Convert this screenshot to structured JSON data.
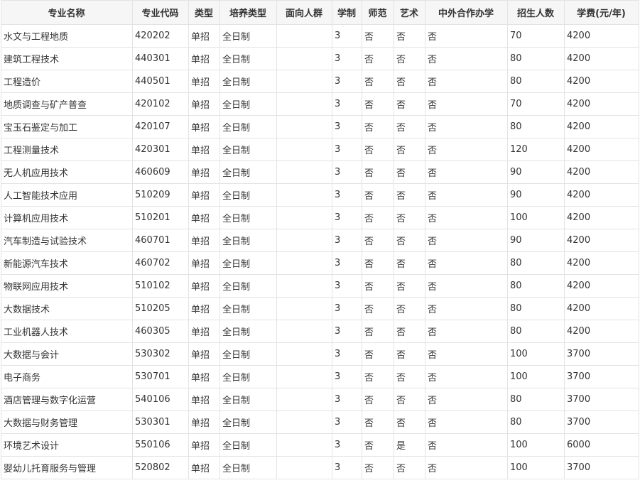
{
  "table": {
    "headers": [
      "专业名称",
      "专业代码",
      "类型",
      "培养类型",
      "面向人群",
      "学制",
      "师范",
      "艺术",
      "中外合作办学",
      "招生人数",
      "学费(元/年)"
    ],
    "rows": [
      [
        "水文与工程地质",
        "420202",
        "单招",
        "全日制",
        "",
        "3",
        "否",
        "否",
        "否",
        "70",
        "4200"
      ],
      [
        "建筑工程技术",
        "440301",
        "单招",
        "全日制",
        "",
        "3",
        "否",
        "否",
        "否",
        "80",
        "4200"
      ],
      [
        "工程造价",
        "440501",
        "单招",
        "全日制",
        "",
        "3",
        "否",
        "否",
        "否",
        "80",
        "4200"
      ],
      [
        "地质调查与矿产普查",
        "420102",
        "单招",
        "全日制",
        "",
        "3",
        "否",
        "否",
        "否",
        "70",
        "4200"
      ],
      [
        "宝玉石鉴定与加工",
        "420107",
        "单招",
        "全日制",
        "",
        "3",
        "否",
        "否",
        "否",
        "80",
        "4200"
      ],
      [
        "工程测量技术",
        "420301",
        "单招",
        "全日制",
        "",
        "3",
        "否",
        "否",
        "否",
        "120",
        "4200"
      ],
      [
        "无人机应用技术",
        "460609",
        "单招",
        "全日制",
        "",
        "3",
        "否",
        "否",
        "否",
        "90",
        "4200"
      ],
      [
        "人工智能技术应用",
        "510209",
        "单招",
        "全日制",
        "",
        "3",
        "否",
        "否",
        "否",
        "90",
        "4200"
      ],
      [
        "计算机应用技术",
        "510201",
        "单招",
        "全日制",
        "",
        "3",
        "否",
        "否",
        "否",
        "100",
        "4200"
      ],
      [
        "汽车制造与试验技术",
        "460701",
        "单招",
        "全日制",
        "",
        "3",
        "否",
        "否",
        "否",
        "90",
        "4200"
      ],
      [
        "新能源汽车技术",
        "460702",
        "单招",
        "全日制",
        "",
        "3",
        "否",
        "否",
        "否",
        "80",
        "4200"
      ],
      [
        "物联网应用技术",
        "510102",
        "单招",
        "全日制",
        "",
        "3",
        "否",
        "否",
        "否",
        "80",
        "4200"
      ],
      [
        "大数据技术",
        "510205",
        "单招",
        "全日制",
        "",
        "3",
        "否",
        "否",
        "否",
        "80",
        "4200"
      ],
      [
        "工业机器人技术",
        "460305",
        "单招",
        "全日制",
        "",
        "3",
        "否",
        "否",
        "否",
        "80",
        "4200"
      ],
      [
        "大数据与会计",
        "530302",
        "单招",
        "全日制",
        "",
        "3",
        "否",
        "否",
        "否",
        "100",
        "3700"
      ],
      [
        "电子商务",
        "530701",
        "单招",
        "全日制",
        "",
        "3",
        "否",
        "否",
        "否",
        "100",
        "3700"
      ],
      [
        "酒店管理与数字化运营",
        "540106",
        "单招",
        "全日制",
        "",
        "3",
        "否",
        "否",
        "否",
        "80",
        "3700"
      ],
      [
        "大数据与财务管理",
        "530301",
        "单招",
        "全日制",
        "",
        "3",
        "否",
        "否",
        "否",
        "80",
        "3700"
      ],
      [
        "环境艺术设计",
        "550106",
        "单招",
        "全日制",
        "",
        "3",
        "否",
        "是",
        "否",
        "100",
        "6000"
      ],
      [
        "婴幼儿托育服务与管理",
        "520802",
        "单招",
        "全日制",
        "",
        "3",
        "否",
        "否",
        "否",
        "100",
        "3700"
      ]
    ]
  }
}
